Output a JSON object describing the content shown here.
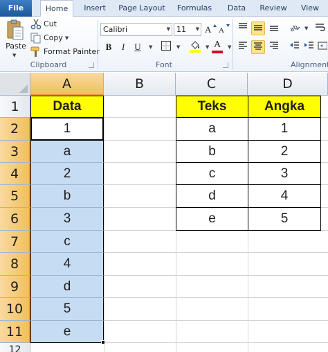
{
  "tabs": [
    {
      "id": "file",
      "label": "File"
    },
    {
      "id": "home",
      "label": "Home"
    },
    {
      "id": "insert",
      "label": "Insert"
    },
    {
      "id": "page_layout",
      "label": "Page Layout"
    },
    {
      "id": "formulas",
      "label": "Formulas"
    },
    {
      "id": "data",
      "label": "Data"
    },
    {
      "id": "review",
      "label": "Review"
    },
    {
      "id": "view",
      "label": "View"
    }
  ],
  "active_tab": "Home",
  "ribbon": {
    "clipboard": {
      "paste_label": "Paste",
      "cut_label": "Cut",
      "copy_label": "Copy",
      "format_painter_label": "Format Painter",
      "group_label": "Clipboard"
    },
    "font": {
      "font_name": "Calibri",
      "font_size": "11",
      "bold": "B",
      "italic": "I",
      "underline": "U",
      "font_color_glyph": "A",
      "group_label": "Font",
      "highlight_color": "#ffff00",
      "font_color": "#e0001b"
    },
    "alignment": {
      "group_label": "Alignment"
    }
  },
  "grid": {
    "columns": [
      "A",
      "B",
      "C",
      "D"
    ],
    "rows": [
      "1",
      "2",
      "3",
      "4",
      "5",
      "6",
      "7",
      "8",
      "9",
      "10",
      "11",
      "12"
    ],
    "colA": {
      "header": "Data",
      "values": [
        "1",
        "a",
        "2",
        "b",
        "3",
        "c",
        "4",
        "d",
        "5",
        "e"
      ]
    },
    "table": {
      "headers": [
        "Teks",
        "Angka"
      ],
      "rows": [
        [
          "a",
          "1"
        ],
        [
          "b",
          "2"
        ],
        [
          "c",
          "3"
        ],
        [
          "d",
          "4"
        ],
        [
          "e",
          "5"
        ]
      ]
    },
    "colors": {
      "header_fill": "#ffff00",
      "selection_fill": "#c5dcf3",
      "selected_header": "#f1c05c"
    }
  }
}
